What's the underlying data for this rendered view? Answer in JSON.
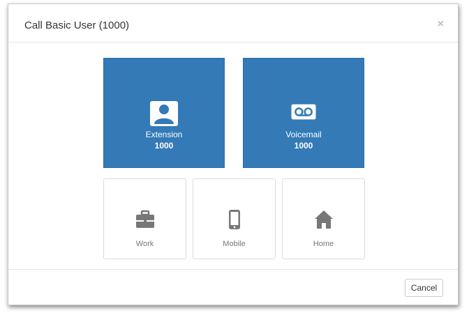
{
  "dialog": {
    "title": "Call Basic User (1000)",
    "close_glyph": "×"
  },
  "options": {
    "extension": {
      "label": "Extension",
      "number": "1000",
      "icon": "contact-card-icon"
    },
    "voicemail": {
      "label": "Voicemail",
      "number": "1000",
      "icon": "voicemail-icon"
    },
    "work": {
      "label": "Work",
      "icon": "briefcase-icon"
    },
    "mobile": {
      "label": "Mobile",
      "icon": "mobile-phone-icon"
    },
    "home": {
      "label": "Home",
      "icon": "home-icon"
    }
  },
  "footer": {
    "cancel_label": "Cancel"
  },
  "colors": {
    "primary_tile": "#337ab7",
    "disabled_icon": "#777777"
  }
}
